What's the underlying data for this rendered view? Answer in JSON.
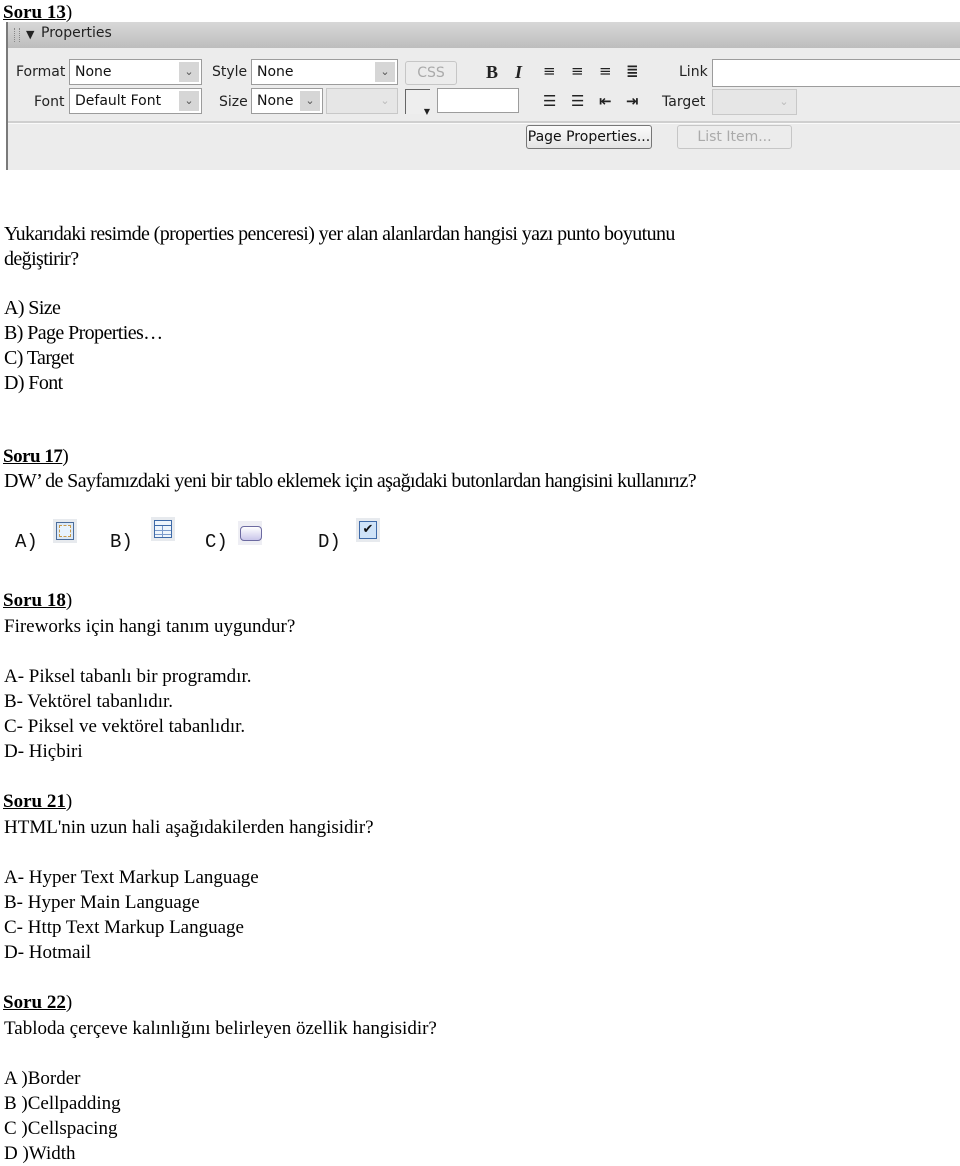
{
  "q13": {
    "header": {
      "label": "Soru 13",
      "paren": ")"
    },
    "panel": {
      "title": "Properties",
      "format_label": "Format",
      "format_value": "None",
      "font_label": "Font",
      "font_value": "Default Font",
      "style_label": "Style",
      "style_value": "None",
      "size_label": "Size",
      "size_value": "None",
      "css_button": "CSS",
      "bold_label": "B",
      "italic_label": "I",
      "link_label": "Link",
      "link_value": "",
      "target_label": "Target",
      "page_properties_button": "Page Properties...",
      "list_item_button": "List Item..."
    },
    "question_lines": [
      "Yukarıdaki resimde (properties penceresi) yer alan alanlardan hangisi yazı punto boyutunu",
      "değiştirir?"
    ],
    "options": [
      "A) Size",
      "B) Page Properties…",
      "C) Target",
      "D) Font"
    ]
  },
  "q17": {
    "header": {
      "label": "Soru 17",
      "paren": ")"
    },
    "question": "DW’ de Sayfamızdaki yeni bir tablo eklemek için aşağıdaki butonlardan hangisini kullanırız?",
    "options": [
      {
        "label": "A)",
        "icon": "layer-div-icon"
      },
      {
        "label": "B)",
        "icon": "table-icon"
      },
      {
        "label": "C)",
        "icon": "button-icon"
      },
      {
        "label": "D)",
        "icon": "checkbox-icon"
      }
    ]
  },
  "q18": {
    "header": {
      "label": "Soru 18",
      "paren": ")"
    },
    "question": "Fireworks için hangi tanım uygundur?",
    "options": [
      "A- Piksel tabanlı bir programdır.",
      "B- Vektörel tabanlıdır.",
      "C- Piksel ve vektörel tabanlıdır.",
      "D- Hiçbiri"
    ]
  },
  "q21": {
    "header": {
      "label": "Soru 21",
      "paren": ")"
    },
    "question": "HTML'nin uzun hali aşağıdakilerden hangisidir?",
    "options": [
      "A- Hyper Text Markup Language",
      "B- Hyper Main Language",
      "C- Http Text Markup Language",
      "D- Hotmail"
    ]
  },
  "q22": {
    "header": {
      "label": "Soru 22",
      "paren": ")"
    },
    "question": "Tabloda çerçeve kalınlığını belirleyen özellik hangisidir?",
    "options": [
      "A )Border",
      "B )Cellpadding",
      "C )Cellspacing",
      "D )Width"
    ]
  }
}
